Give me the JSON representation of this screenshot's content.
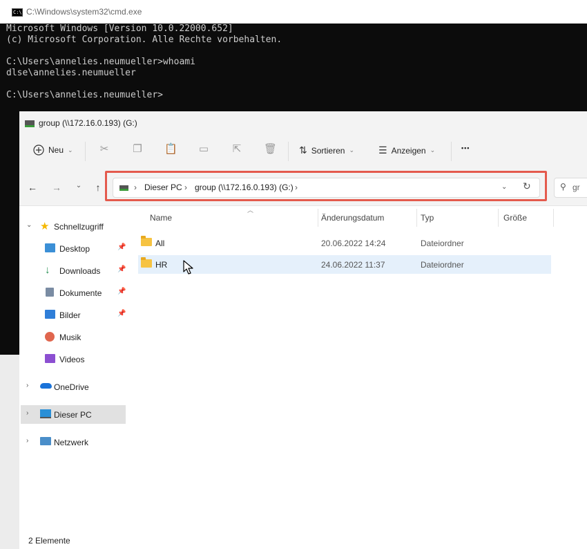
{
  "cmd": {
    "title": "C:\\Windows\\system32\\cmd.exe",
    "icon_label": "C:\\",
    "lines": [
      "Microsoft Windows [Version 10.0.22000.652]",
      "(c) Microsoft Corporation. Alle Rechte vorbehalten.",
      "",
      "C:\\Users\\annelies.neumueller>whoami",
      "dlse\\annelies.neumueller",
      "",
      "C:\\Users\\annelies.neumueller>"
    ]
  },
  "explorer": {
    "title": "group (\\\\172.16.0.193) (G:)",
    "toolbar": {
      "new_label": "Neu",
      "sort_label": "Sortieren",
      "view_label": "Anzeigen",
      "more_label": "•••"
    },
    "address": {
      "crumbs": [
        "Dieser PC",
        "group (\\\\172.16.0.193) (G:)"
      ],
      "search_placeholder": "gr"
    },
    "sidebar": {
      "quick_access": "Schnellzugriff",
      "pinned": [
        {
          "label": "Desktop",
          "icon": "desktop-icon",
          "pinned": true
        },
        {
          "label": "Downloads",
          "icon": "downloads-icon",
          "pinned": true
        },
        {
          "label": "Dokumente",
          "icon": "documents-icon",
          "pinned": true
        },
        {
          "label": "Bilder",
          "icon": "pictures-icon",
          "pinned": true
        },
        {
          "label": "Musik",
          "icon": "music-icon",
          "pinned": false
        },
        {
          "label": "Videos",
          "icon": "videos-icon",
          "pinned": false
        }
      ],
      "onedrive": "OneDrive",
      "this_pc": "Dieser PC",
      "network": "Netzwerk"
    },
    "columns": [
      "Name",
      "Änderungsdatum",
      "Typ",
      "Größe"
    ],
    "rows": [
      {
        "name": "All",
        "date": "20.06.2022 14:24",
        "type": "Dateiordner",
        "size": ""
      },
      {
        "name": "HR",
        "date": "24.06.2022 11:37",
        "type": "Dateiordner",
        "size": ""
      }
    ],
    "status": "2 Elemente"
  },
  "colors": {
    "cmd_bg": "#0c0c0c",
    "cmd_text": "#cccccc",
    "highlight_box": "#e45a4d",
    "selected_row": "#e5f0fb",
    "folder": "#f6c342"
  }
}
